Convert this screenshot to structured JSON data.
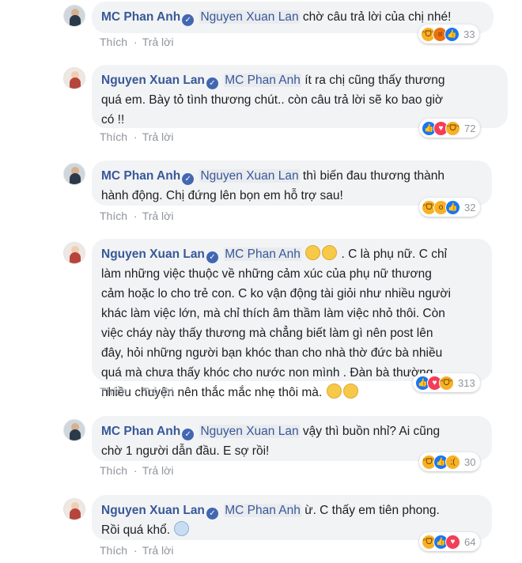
{
  "comments": [
    {
      "author": "MC Phan Anh",
      "avatar": "mc",
      "mention": "Nguyen Xuan Lan",
      "text_lines": [
        "chờ câu trả lời của chị nhé!"
      ],
      "like": "Thích",
      "reply": "Trả lời",
      "reactions": [
        "haha-icon",
        "angry-icon",
        "like-icon"
      ],
      "count": "33"
    },
    {
      "author": "Nguyen Xuan Lan",
      "avatar": "lan",
      "mention": "MC Phan Anh",
      "text_lines": [
        "ít ra chị cũng thấy thương",
        "quá em. Bày tỏ tình thương chút.. còn câu trả lời sẽ ko bao giờ",
        "có !!"
      ],
      "like": "Thích",
      "reply": "Trả lời",
      "reactions": [
        "like-icon",
        "love-icon",
        "haha-icon"
      ],
      "count": "72"
    },
    {
      "author": "MC Phan Anh",
      "avatar": "mc",
      "mention": "Nguyen Xuan Lan",
      "text_lines": [
        "thì biến đau thương thành",
        "hành động. Chị đứng lên bọn em hỗ trợ sau!"
      ],
      "like": "Thích",
      "reply": "Trả lời",
      "reactions": [
        "haha-icon",
        "wow-icon",
        "like-icon"
      ],
      "count": "32"
    },
    {
      "author": "Nguyen Xuan Lan",
      "avatar": "lan",
      "mention": "MC Phan Anh",
      "text_lines": [
        ". C là phụ nữ. C chỉ",
        "làm những việc thuộc về những cảm xúc của phụ nữ thương",
        "cảm hoặc lo cho trẻ con. C ko vận động tài giỏi như nhiều người",
        "khác làm việc lớn, mà chỉ thích âm thầm làm việc nhỏ thôi. Còn",
        "việc cháy này thấy thương mà chẳng biết làm gì nên post lên",
        "đây, hỏi những người bạn khóc than cho nhà thờ đức bà nhiều",
        "quá mà chưa thấy khóc cho nước non mình . Đàn bà thường",
        "nhiều chuyện nên thắc mắc nhẹ thôi mà."
      ],
      "like": "Thích",
      "reply": "Trả lời",
      "reactions": [
        "like-icon",
        "love-icon",
        "haha-icon"
      ],
      "count": "313"
    },
    {
      "author": "MC Phan Anh",
      "avatar": "mc",
      "mention": "Nguyen Xuan Lan",
      "text_lines": [
        "vậy thì buồn nhỉ? Ai cũng",
        "chờ 1 người dẫn đầu. E sợ rồi!"
      ],
      "like": "Thích",
      "reply": "Trả lời",
      "reactions": [
        "haha-icon",
        "like-icon",
        "sad-icon"
      ],
      "count": "30"
    },
    {
      "author": "Nguyen Xuan Lan",
      "avatar": "lan",
      "mention": "MC Phan Anh",
      "text_lines": [
        "ừ. C thấy em tiên phong.",
        "Rồi quá khổ."
      ],
      "like": "Thích",
      "reply": "Trả lời",
      "reactions": [
        "haha-icon",
        "like-icon",
        "love-icon"
      ],
      "count": "64"
    }
  ],
  "colors": {
    "author": "#385898",
    "bubble": "#f2f3f5",
    "meta": "#90949c",
    "like": "#1877f2",
    "love": "#f33e58",
    "haha": "#f7b125"
  }
}
